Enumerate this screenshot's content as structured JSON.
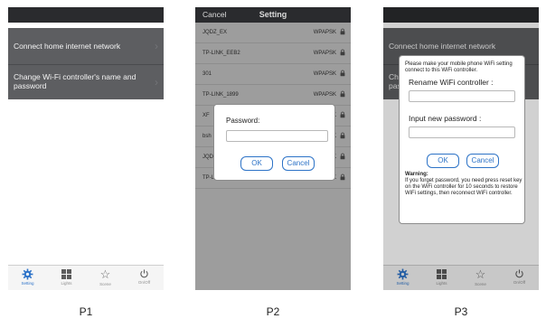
{
  "p1": {
    "menu": [
      {
        "label": "Connect home internet network"
      },
      {
        "label": "Change Wi-Fi controller's name  and password"
      }
    ]
  },
  "p2": {
    "header": {
      "cancel": "Cancel",
      "title": "Setting"
    },
    "networks": [
      {
        "ssid": "JQDZ_EX",
        "security": "WPAPSK"
      },
      {
        "ssid": "TP-LINK_EEB2",
        "security": "WPAPSK"
      },
      {
        "ssid": "301",
        "security": "WPAPSK"
      },
      {
        "ssid": "TP-LINK_1899",
        "security": "WPAPSK"
      },
      {
        "ssid": "XF",
        "security": "K"
      },
      {
        "ssid": "bsh",
        "security": "K"
      },
      {
        "ssid": "JQD",
        "security": "K"
      },
      {
        "ssid": "TP-L",
        "security": "K"
      }
    ],
    "dialog": {
      "label": "Password:",
      "ok": "OK",
      "cancel": "Cancel"
    }
  },
  "p3": {
    "bg_menu": {
      "item1": "Connect home internet network",
      "item2_a": "Chan",
      "item2_b": "pass"
    },
    "dialog": {
      "intro": "Please make your mobile phone WiFi setting connect to this WiFi controller.",
      "rename_label": "Rename WiFi controller :",
      "password_label": "Input new password :",
      "ok": "OK",
      "cancel": "Cancel",
      "warning_title": "Warning:",
      "warning_text": "If you forget password, you need press reset key on the WiFi controller for 10 seconds to restore WiFi settings, then reconnect WiFi controller."
    }
  },
  "tabs": [
    {
      "label": "Setting",
      "icon": "gear-icon"
    },
    {
      "label": "Lights",
      "icon": "grid-icon"
    },
    {
      "label": "Scene",
      "icon": "star-icon"
    },
    {
      "label": "On/Off",
      "icon": "power-icon"
    }
  ],
  "captions": [
    "P1",
    "P2",
    "P3"
  ],
  "colors": {
    "accent": "#2f74c9",
    "menu_bg": "#5d5e61",
    "top_bar": "#2a2b2e",
    "list_bg": "#ababab"
  }
}
